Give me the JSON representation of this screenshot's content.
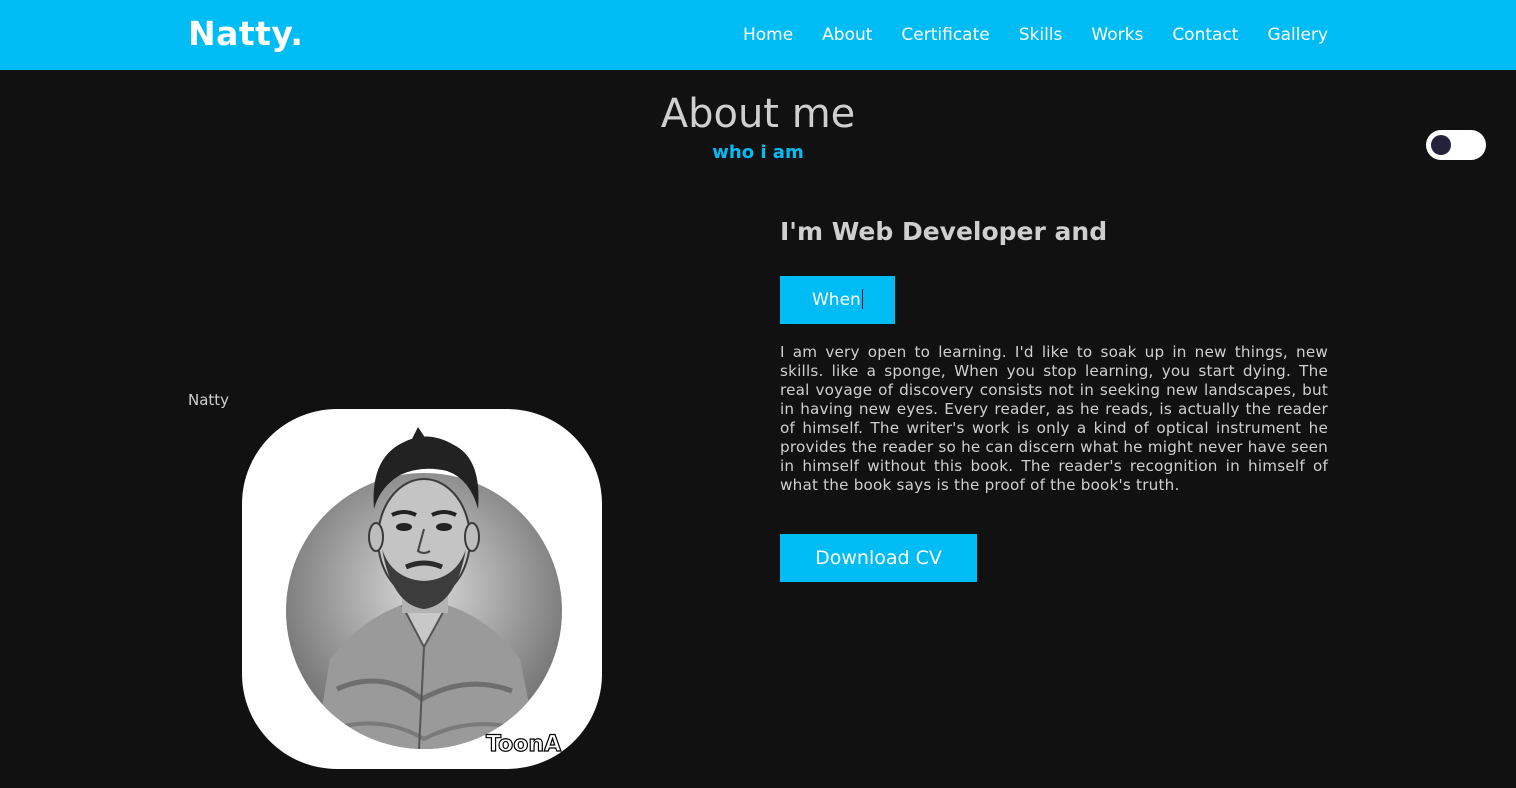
{
  "brand": {
    "logo": "Natty."
  },
  "nav": {
    "items": [
      {
        "label": "Home"
      },
      {
        "label": "About"
      },
      {
        "label": "Certificate"
      },
      {
        "label": "Skills"
      },
      {
        "label": "Works"
      },
      {
        "label": "Contact"
      },
      {
        "label": "Gallery"
      }
    ]
  },
  "theme_toggle": {
    "icon": "dark-mode-toggle-icon"
  },
  "section": {
    "title": "About me",
    "subtitle": "who i am"
  },
  "profile": {
    "image_caption": "Natty",
    "image_watermark": "ToonApp"
  },
  "content": {
    "headline": "I'm Web Developer and",
    "typed_text": "When",
    "bio": "I am very open to learning. I'd like to soak up in new things, new skills. like a sponge, When you stop learning, you start dying. The real voyage of discovery consists not in seeking new landscapes, but in having new eyes. Every reader, as he reads, is actually the reader of himself. The writer's work is only a kind of optical instrument he provides the reader so he can discern what he might never have seen in himself without this book. The reader's recognition in himself of what the book says is the proof of the book's truth.",
    "cv_button": "Download CV"
  },
  "colors": {
    "accent": "#00bcf5",
    "background": "#111111",
    "text": "#cfcfcf",
    "toggle_knob": "#23223a"
  }
}
